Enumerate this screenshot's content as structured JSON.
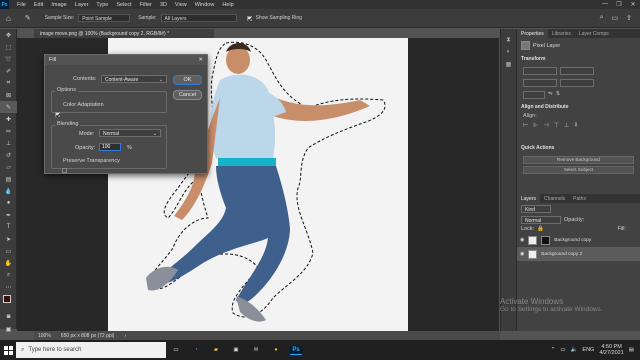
{
  "menubar": {
    "logo": "Ps",
    "items": [
      "File",
      "Edit",
      "Image",
      "Layer",
      "Type",
      "Select",
      "Filter",
      "3D",
      "View",
      "Window",
      "Help"
    ],
    "window_controls": [
      "—",
      "❐",
      "✕"
    ]
  },
  "options_bar": {
    "sample_size_label": "Sample Size:",
    "sample_size_value": "Point Sample",
    "sample_label": "Sample:",
    "sample_value": "All Layers",
    "show_ring_label": "Show Sampling Ring"
  },
  "document": {
    "tab_title": "image move.png @ 100% (Background copy 2, RGB/8#) *",
    "zoom": "100%",
    "doc_info": "650 px x 808 px (72 ppi)"
  },
  "fill_dialog": {
    "title": "Fill",
    "contents_label": "Contents:",
    "contents_value": "Content-Aware",
    "ok_label": "OK",
    "cancel_label": "Cancel",
    "options_group": "Options",
    "color_adaptation_label": "Color Adaptation",
    "color_adaptation_checked": true,
    "blending_group": "Blending",
    "mode_label": "Mode:",
    "mode_value": "Normal",
    "opacity_label": "Opacity:",
    "opacity_value": "100",
    "opacity_unit": "%",
    "preserve_transparency_label": "Preserve Transparency",
    "preserve_transparency_checked": false
  },
  "properties_panel": {
    "tabs": [
      "Properties",
      "Libraries",
      "Layer Comps"
    ],
    "kind": "Pixel Layer",
    "transform_header": "Transform",
    "align_header": "Align and Distribute",
    "align_label": "Align:",
    "quick_actions_header": "Quick Actions",
    "remove_bg_label": "Remove Background",
    "select_subject_label": "Select Subject"
  },
  "layers_panel": {
    "tabs": [
      "Layers",
      "Channels",
      "Paths"
    ],
    "kind_label": "Kind",
    "mode_value": "Normal",
    "opacity_label": "Opacity:",
    "lock_label": "Lock:",
    "fill_label": "Fill:",
    "layers": [
      {
        "name": "Background copy"
      },
      {
        "name": "Background copy 2"
      }
    ]
  },
  "watermark": {
    "line1": "Activate Windows",
    "line2": "Go to Settings to activate Windows."
  },
  "taskbar": {
    "search_placeholder": "Type here to search",
    "ps_label": "Ps",
    "lang": "ENG",
    "time": "4:50 PM",
    "date": "4/27/2021"
  },
  "colors": {
    "menubar_bg": "#323232",
    "panel_bg": "#424242",
    "accent": "#2f7bd8",
    "ps_blue": "#31a8ff"
  }
}
